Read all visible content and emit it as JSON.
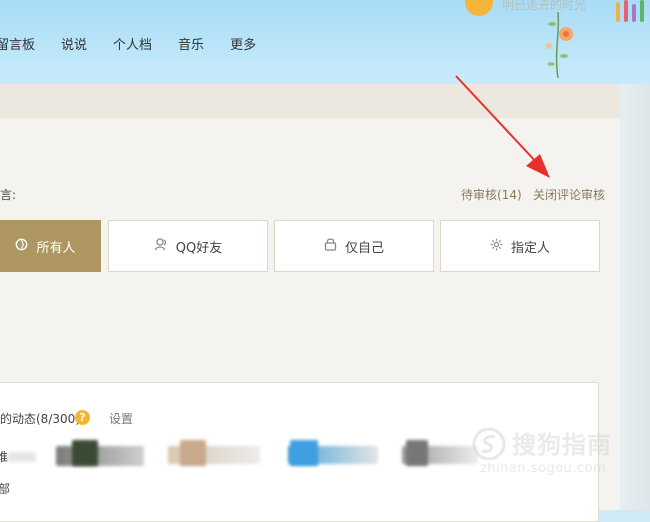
{
  "nav": {
    "items": [
      "留言板",
      "说说",
      "个人档",
      "音乐",
      "更多"
    ]
  },
  "header": {
    "faded_text": "明已逝去的时光"
  },
  "permission": {
    "label": "言:",
    "pending_review": "待审核(14)",
    "close_review": "关闭评论审核",
    "options": [
      {
        "label": "所有人",
        "icon": "globe-icon",
        "active": true
      },
      {
        "label": "QQ好友",
        "icon": "friend-icon",
        "active": false
      },
      {
        "label": "仅自己",
        "icon": "lock-icon",
        "active": false
      },
      {
        "label": "指定人",
        "icon": "gear-icon",
        "active": false
      }
    ]
  },
  "feed_settings": {
    "title": "的动态(8/300)",
    "help": "?",
    "settings": "设置",
    "fragments": [
      "谁",
      "部"
    ]
  },
  "watermark": {
    "brand": "搜狗指南",
    "url": "zhinan.sogou.com"
  },
  "colors": {
    "accent": "#ad9662",
    "arrow": "#e8302a",
    "help_badge": "#f5b52e"
  }
}
